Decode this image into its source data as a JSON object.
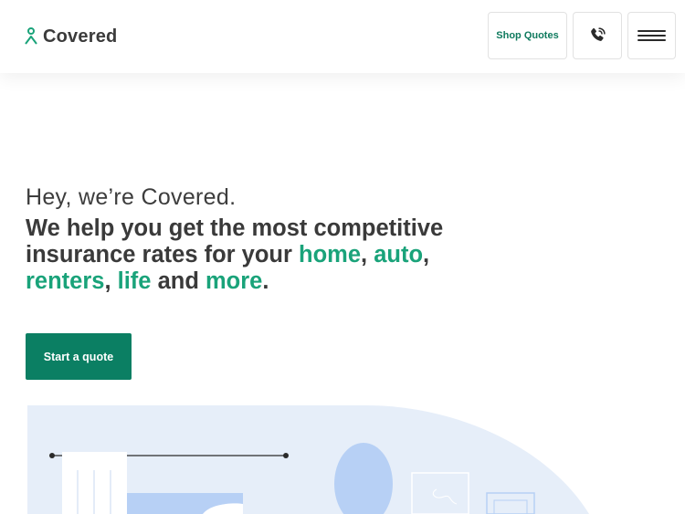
{
  "header": {
    "logo_text": "Covered",
    "shop_quotes_label": "Shop Quotes",
    "phone_icon": "phone-icon",
    "menu_icon": "hamburger-menu-icon"
  },
  "hero": {
    "intro": "Hey, we’re Covered.",
    "headline": {
      "part1": "We help you get the most competitive insurance rates for your ",
      "home": "home",
      "sep1": ", ",
      "auto": "auto",
      "sep2": ", ",
      "renters": "renters",
      "sep3": ", ",
      "life": "life",
      "and": " and ",
      "more": "more",
      "end": "."
    },
    "cta_label": "Start a quote"
  },
  "colors": {
    "brand_green": "#0b7f63",
    "highlight_green": "#1aa37a",
    "text_dark": "#3a3a3a",
    "illustration_bg": "#e6eef9",
    "illustration_blue": "#b7d0f5"
  }
}
